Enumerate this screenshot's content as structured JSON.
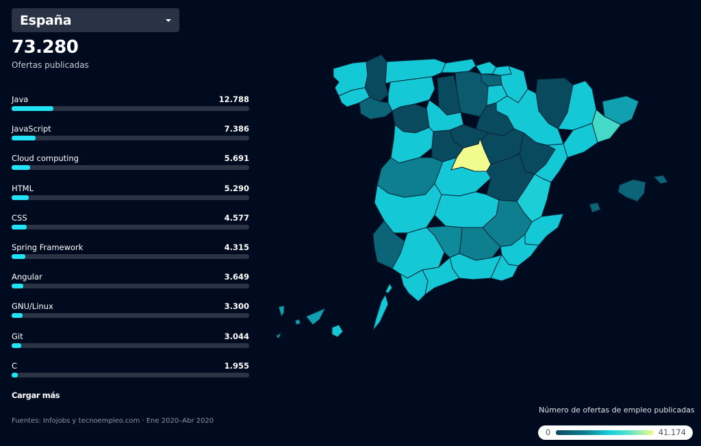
{
  "selector": {
    "label": "España",
    "icon": "caret-down-icon"
  },
  "summary": {
    "total": "73.280",
    "label": "Ofertas publicadas"
  },
  "skills": [
    {
      "name": "Java",
      "value": "12.788",
      "share": 0.1745
    },
    {
      "name": "JavaScript",
      "value": "7.386",
      "share": 0.1008
    },
    {
      "name": "Cloud computing",
      "value": "5.691",
      "share": 0.0777
    },
    {
      "name": "HTML",
      "value": "5.290",
      "share": 0.0722
    },
    {
      "name": "CSS",
      "value": "4.577",
      "share": 0.0625
    },
    {
      "name": "Spring Framework",
      "value": "4.315",
      "share": 0.0589
    },
    {
      "name": "Angular",
      "value": "3.649",
      "share": 0.0498
    },
    {
      "name": "GNU/Linux",
      "value": "3.300",
      "share": 0.045
    },
    {
      "name": "Git",
      "value": "3.044",
      "share": 0.0415
    },
    {
      "name": "C",
      "value": "1.955",
      "share": 0.0267
    }
  ],
  "load_more": "Cargar más",
  "source": "Fuentes: Infojobs y tecnoempleo.com · Ene 2020–Abr 2020",
  "legend": {
    "title": "Número de ofertas de empleo publicadas",
    "min": "0",
    "max": "41.174",
    "colors": [
      "#0a4a5e",
      "#0e7f8e",
      "#16d0df",
      "#5de3c9",
      "#f2fb8e"
    ]
  },
  "map": {
    "highlight_color": "#f2fb8e",
    "regions": [
      {
        "id": "a-coruna",
        "color": "#14c8d6"
      },
      {
        "id": "lugo",
        "color": "#0a4a5e"
      },
      {
        "id": "asturias",
        "color": "#14c8d6"
      },
      {
        "id": "cantabria",
        "color": "#14c8d6"
      },
      {
        "id": "bizkaia",
        "color": "#14c8d6"
      },
      {
        "id": "gipuzkoa",
        "color": "#14c8d6"
      },
      {
        "id": "navarra",
        "color": "#14c8d6"
      },
      {
        "id": "huesca",
        "color": "#0a4a5e"
      },
      {
        "id": "lleida",
        "color": "#14c8d6"
      },
      {
        "id": "girona",
        "color": "#10a0b0"
      },
      {
        "id": "barcelona",
        "color": "#45d9c8"
      },
      {
        "id": "pontevedra",
        "color": "#14c8d6"
      },
      {
        "id": "ourense",
        "color": "#0c6478"
      },
      {
        "id": "leon",
        "color": "#14c8d6"
      },
      {
        "id": "palencia",
        "color": "#0a4a5e"
      },
      {
        "id": "burgos",
        "color": "#0c5a6e"
      },
      {
        "id": "alava",
        "color": "#0c6478"
      },
      {
        "id": "la-rioja",
        "color": "#14c8d6"
      },
      {
        "id": "zaragoza",
        "color": "#14c8d6"
      },
      {
        "id": "tarragona",
        "color": "#14c8d6"
      },
      {
        "id": "zamora",
        "color": "#0a4a5e"
      },
      {
        "id": "valladolid",
        "color": "#14c8d6"
      },
      {
        "id": "soria",
        "color": "#0a4a5e"
      },
      {
        "id": "salamanca",
        "color": "#14c8d6"
      },
      {
        "id": "avila",
        "color": "#0a4a5e"
      },
      {
        "id": "segovia",
        "color": "#0a4a5e"
      },
      {
        "id": "guadalajara",
        "color": "#0a4a5e"
      },
      {
        "id": "teruel",
        "color": "#0a4a5e"
      },
      {
        "id": "castellon",
        "color": "#14c8d6"
      },
      {
        "id": "madrid",
        "color": "#f2fb8e"
      },
      {
        "id": "caceres",
        "color": "#0e7f8e"
      },
      {
        "id": "toledo",
        "color": "#14c8d6"
      },
      {
        "id": "cuenca",
        "color": "#0a4a5e"
      },
      {
        "id": "valencia",
        "color": "#1ccfd6"
      },
      {
        "id": "badajoz",
        "color": "#14c8d6"
      },
      {
        "id": "ciudad-real",
        "color": "#14c8d6"
      },
      {
        "id": "albacete",
        "color": "#0e7f8e"
      },
      {
        "id": "alicante",
        "color": "#14c8d6"
      },
      {
        "id": "huelva",
        "color": "#0c6478"
      },
      {
        "id": "sevilla",
        "color": "#14c8d6"
      },
      {
        "id": "cordoba",
        "color": "#0e8a98"
      },
      {
        "id": "jaen",
        "color": "#0e7f8e"
      },
      {
        "id": "murcia",
        "color": "#14c8d6"
      },
      {
        "id": "granada",
        "color": "#14c8d6"
      },
      {
        "id": "almeria",
        "color": "#14c8d6"
      },
      {
        "id": "cadiz",
        "color": "#14c8d6"
      },
      {
        "id": "malaga",
        "color": "#14c8d6"
      },
      {
        "id": "mallorca",
        "color": "#0c6478"
      },
      {
        "id": "menorca",
        "color": "#0c6478"
      },
      {
        "id": "ibiza",
        "color": "#0c6478"
      },
      {
        "id": "tenerife",
        "color": "#10a0b0"
      },
      {
        "id": "gran-canaria",
        "color": "#14c8d6"
      },
      {
        "id": "lanzarote-fuerteventura",
        "color": "#14c8d6"
      },
      {
        "id": "la-palma",
        "color": "#10a0b0"
      },
      {
        "id": "la-gomera",
        "color": "#10a0b0"
      },
      {
        "id": "el-hierro",
        "color": "#10a0b0"
      }
    ]
  }
}
